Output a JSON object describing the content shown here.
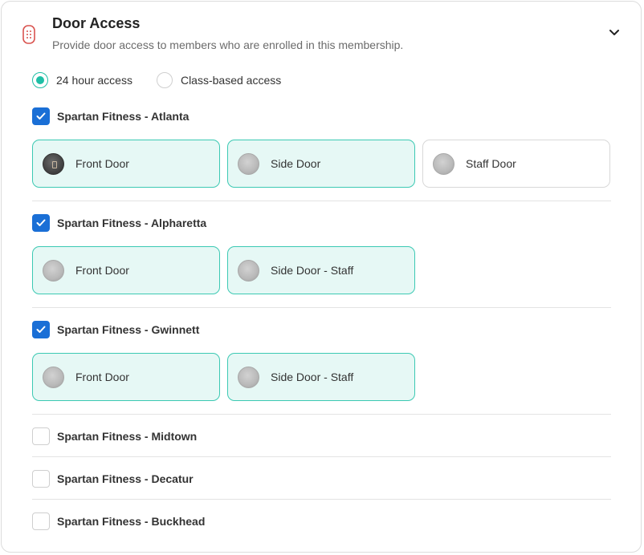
{
  "header": {
    "title": "Door Access",
    "subtitle": "Provide door access to members who are enrolled in this membership."
  },
  "access_type": {
    "options": [
      {
        "label": "24 hour access",
        "selected": true
      },
      {
        "label": "Class-based access",
        "selected": false
      }
    ]
  },
  "colors": {
    "accent": "#1fbfa6",
    "checkbox": "#1a6fd6",
    "door_selected_bg": "#e6f8f5",
    "icon": "#d9534f"
  },
  "locations": [
    {
      "name": "Spartan Fitness - Atlanta",
      "checked": true,
      "doors": [
        {
          "label": "Front Door",
          "selected": true,
          "icon": "dark-lock-icon"
        },
        {
          "label": "Side Door",
          "selected": true,
          "icon": "lock-icon"
        },
        {
          "label": "Staff Door",
          "selected": false,
          "icon": "lock-icon"
        }
      ]
    },
    {
      "name": "Spartan Fitness - Alpharetta",
      "checked": true,
      "doors": [
        {
          "label": "Front Door",
          "selected": true,
          "icon": "lock-icon"
        },
        {
          "label": "Side Door - Staff",
          "selected": true,
          "icon": "lock-icon"
        }
      ]
    },
    {
      "name": "Spartan Fitness - Gwinnett",
      "checked": true,
      "doors": [
        {
          "label": "Front Door",
          "selected": true,
          "icon": "lock-icon"
        },
        {
          "label": "Side Door - Staff",
          "selected": true,
          "icon": "lock-icon"
        }
      ]
    },
    {
      "name": "Spartan Fitness - Midtown",
      "checked": false,
      "doors": []
    },
    {
      "name": "Spartan Fitness - Decatur",
      "checked": false,
      "doors": []
    },
    {
      "name": "Spartan Fitness - Buckhead",
      "checked": false,
      "doors": []
    }
  ]
}
